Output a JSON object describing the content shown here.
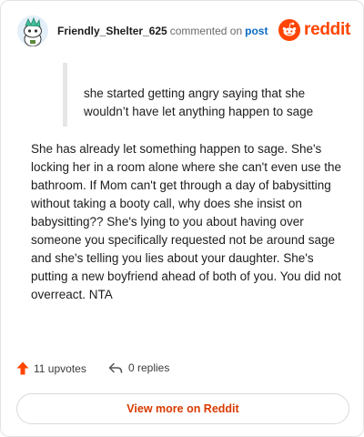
{
  "header": {
    "username": "Friendly_Shelter_625",
    "action_text": "commented on",
    "post_link": "post",
    "brand": "reddit"
  },
  "comment": {
    "quote": "she started getting angry saying that she wouldn’t have let anything happen to sage",
    "body": "She has already let something happen to sage. She's locking her in a room alone where she can't even use the bathroom. If Mom can't get through a day of babysitting without taking a booty call, why does she insist on babysitting?? She's lying to you about having over someone you specifically requested not be around sage and she's telling you lies about your daughter. She's putting a new boyfriend ahead of both of you. You did not overreact. NTA"
  },
  "actions": {
    "upvotes": "11 upvotes",
    "replies": "0 replies"
  },
  "footer": {
    "view_more": "View more on Reddit"
  },
  "colors": {
    "brand": "#ff4500",
    "link": "#0a6bc4",
    "view_more_text": "#d93a00"
  },
  "icons": {
    "avatar": "snoo-avatar-icon",
    "logo": "reddit-snoo-icon",
    "upvote": "upvote-arrow-icon",
    "reply": "reply-arrow-icon"
  }
}
